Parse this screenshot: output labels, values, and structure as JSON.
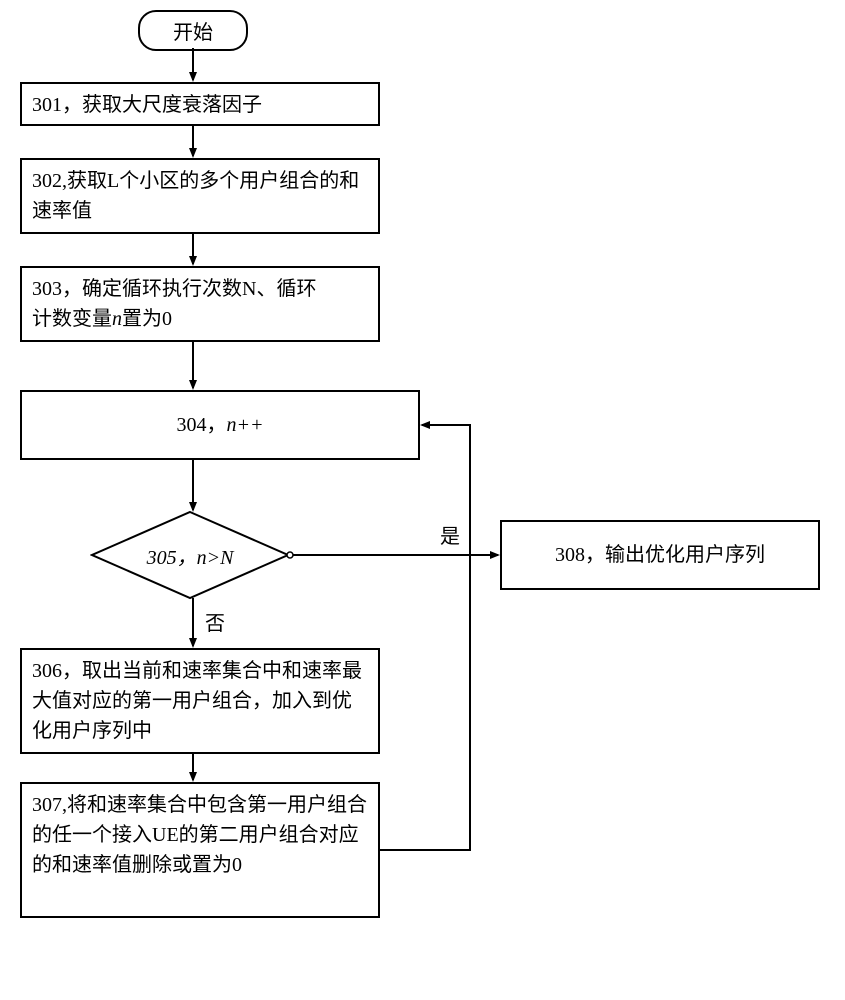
{
  "start": {
    "label": "开始"
  },
  "steps": {
    "s301": "301，获取大尺度衰落因子",
    "s302": "302,获取L个小区的多个用户组合的和速率值",
    "s303_a": "303，确定循环执行次数N、循环",
    "s303_b": "计数变量",
    "s303_c": "n",
    "s303_d": "置为0",
    "s304_a": "304，",
    "s304_b": "n++",
    "s305_a": "305",
    "s305_b": "，",
    "s305_c": "n>N",
    "s306": "306，取出当前和速率集合中和速率最大值对应的第一用户组合，加入到优化用户序列中",
    "s307": "307,将和速率集合中包含第一用户组合的任一个接入UE的第二用户组合对应的和速率值删除或置为0",
    "s308": "308，输出优化用户序列"
  },
  "edges": {
    "yes": "是",
    "no": "否"
  }
}
